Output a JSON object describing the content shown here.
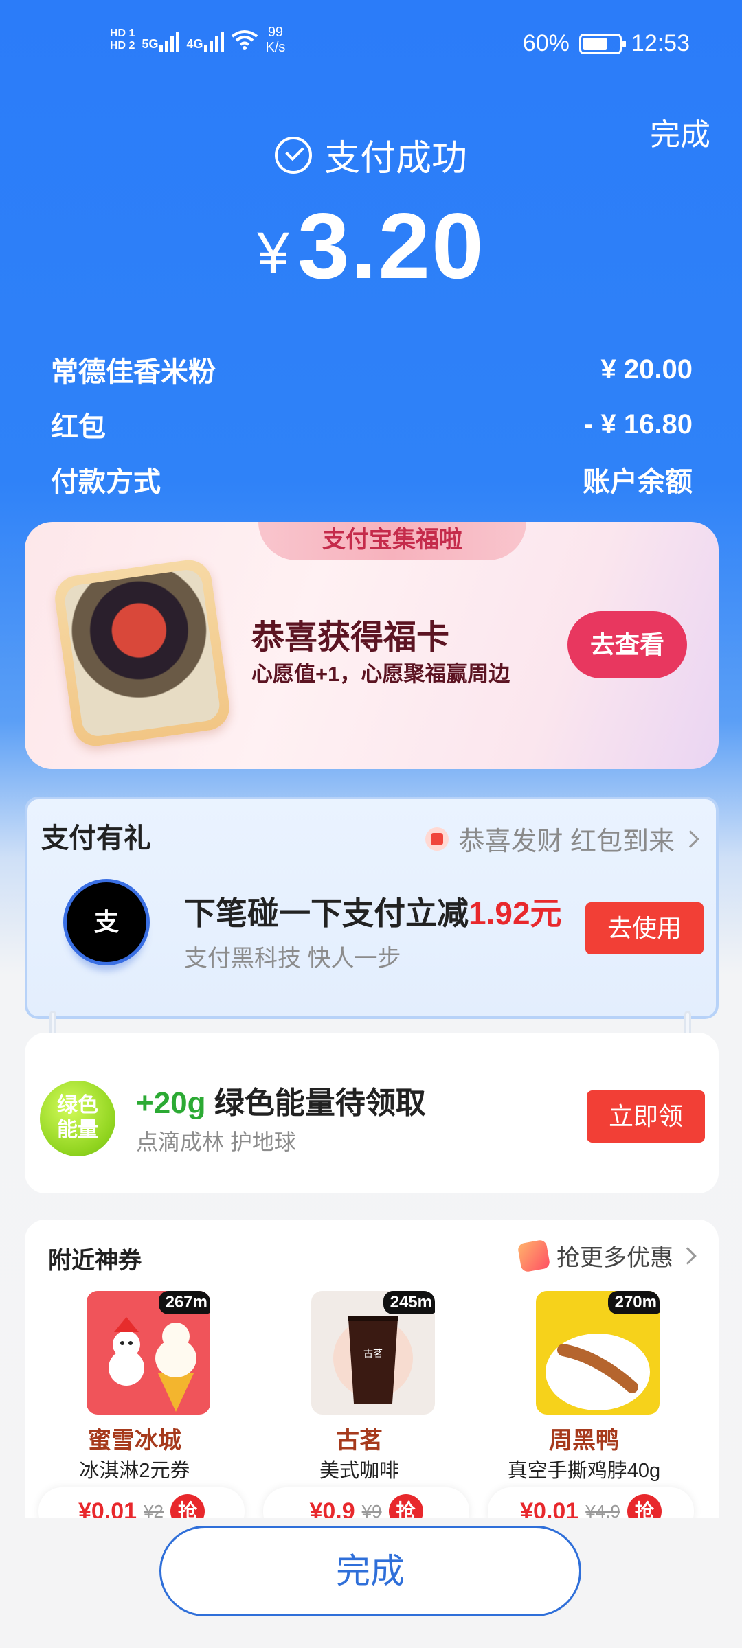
{
  "status_bar": {
    "hd1": "HD 1",
    "hd2": "HD 2",
    "sim1": "5G",
    "sim2": "4G",
    "speed_value": "99",
    "speed_unit": "K/s",
    "battery_pct": "60%",
    "time": "12:53"
  },
  "header": {
    "done_label": "完成",
    "status_text": "支付成功",
    "currency": "¥",
    "amount": "3.20"
  },
  "details": [
    {
      "label": "常德佳香米粉",
      "value": "¥ 20.00"
    },
    {
      "label": "红包",
      "value": "- ¥ 16.80"
    },
    {
      "label": "付款方式",
      "value": "账户余额"
    }
  ],
  "fu_card": {
    "tab": "支付宝集福啦",
    "title": "恭喜获得福卡",
    "subtitle": "心愿值+1，心愿聚福赢周边",
    "button": "去查看"
  },
  "gift_card": {
    "title": "支付有礼",
    "right_text": "恭喜发财 红包到来",
    "icon_text": "支",
    "main_prefix": "下笔碰一下支付立减",
    "main_amount": "1.92元",
    "subtitle": "支付黑科技 快人一步",
    "button": "去使用"
  },
  "energy_card": {
    "icon_line1": "绿色",
    "icon_line2": "能量",
    "amount": "+20g",
    "title": "绿色能量待领取",
    "subtitle": "点滴成林 护地球",
    "button": "立即领"
  },
  "coupons": {
    "title": "附近神券",
    "more": "抢更多优惠",
    "items": [
      {
        "distance": "267m",
        "name": "蜜雪冰城",
        "desc": "冰淇淋2元券",
        "price": "¥0.01",
        "old_price": "¥2",
        "grab": "抢",
        "color": "#f0545a"
      },
      {
        "distance": "245m",
        "name": "古茗",
        "desc": "美式咖啡",
        "price": "¥0.9",
        "old_price": "¥9",
        "grab": "抢",
        "color": "#f1ebe7"
      },
      {
        "distance": "270m",
        "name": "周黑鸭",
        "desc": "真空手撕鸡脖40g",
        "price": "¥0.01",
        "old_price": "¥4.9",
        "grab": "抢",
        "color": "#f6d21b"
      }
    ]
  },
  "footer": {
    "finish_label": "完成"
  }
}
